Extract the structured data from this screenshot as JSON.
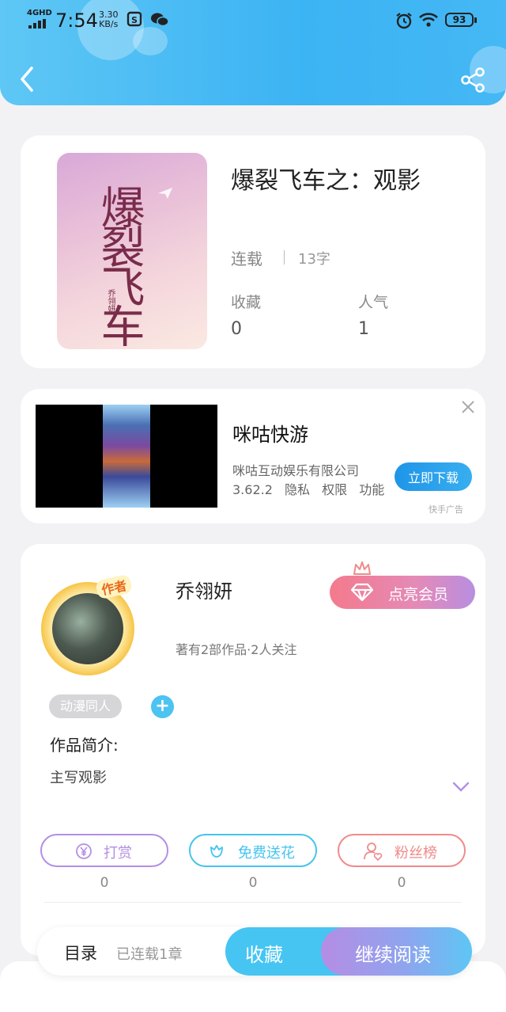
{
  "status_bar": {
    "network": "4GHD",
    "time": "7:54",
    "speed_value": "3.30",
    "speed_unit": "KB/s",
    "battery": "93"
  },
  "header": {
    "back_icon": "chevron-left-icon",
    "share_icon": "share-icon",
    "color": "#3cb3f3"
  },
  "book": {
    "cover_title": "爆裂飞车",
    "cover_author": "乔翎妍",
    "title": "爆裂飞车之：观影",
    "status": "连载",
    "word_count": "13字",
    "favorites_label": "收藏",
    "favorites_value": "0",
    "popularity_label": "人气",
    "popularity_value": "1"
  },
  "ad": {
    "title": "咪咕快游",
    "company": "咪咕互动娱乐有限公司",
    "version": "3.62.2",
    "privacy": "隐私",
    "permissions": "权限",
    "features": "功能",
    "download_label": "立即下载",
    "ad_label": "快手广告",
    "close_icon": "close-icon"
  },
  "author": {
    "badge": "作者",
    "name": "乔翎妍",
    "vip_label": "点亮会员",
    "info": "著有2部作品·2人关注",
    "tag": "动漫同人",
    "add_tag": "+",
    "intro_label": "作品简介:",
    "intro_text": "主写观影"
  },
  "actions": [
    {
      "label": "打赏",
      "icon": "yen-icon",
      "count": "0",
      "color": "#b48ee6"
    },
    {
      "label": "免费送花",
      "icon": "flower-icon",
      "count": "0",
      "color": "#45c4ee"
    },
    {
      "label": "粉丝榜",
      "icon": "fan-user-icon",
      "count": "0",
      "color": "#ef8a8a"
    }
  ],
  "bottom_bar": {
    "toc_label": "目录",
    "toc_info": "已连载1章",
    "favorite_label": "收藏",
    "read_label": "继续阅读"
  }
}
